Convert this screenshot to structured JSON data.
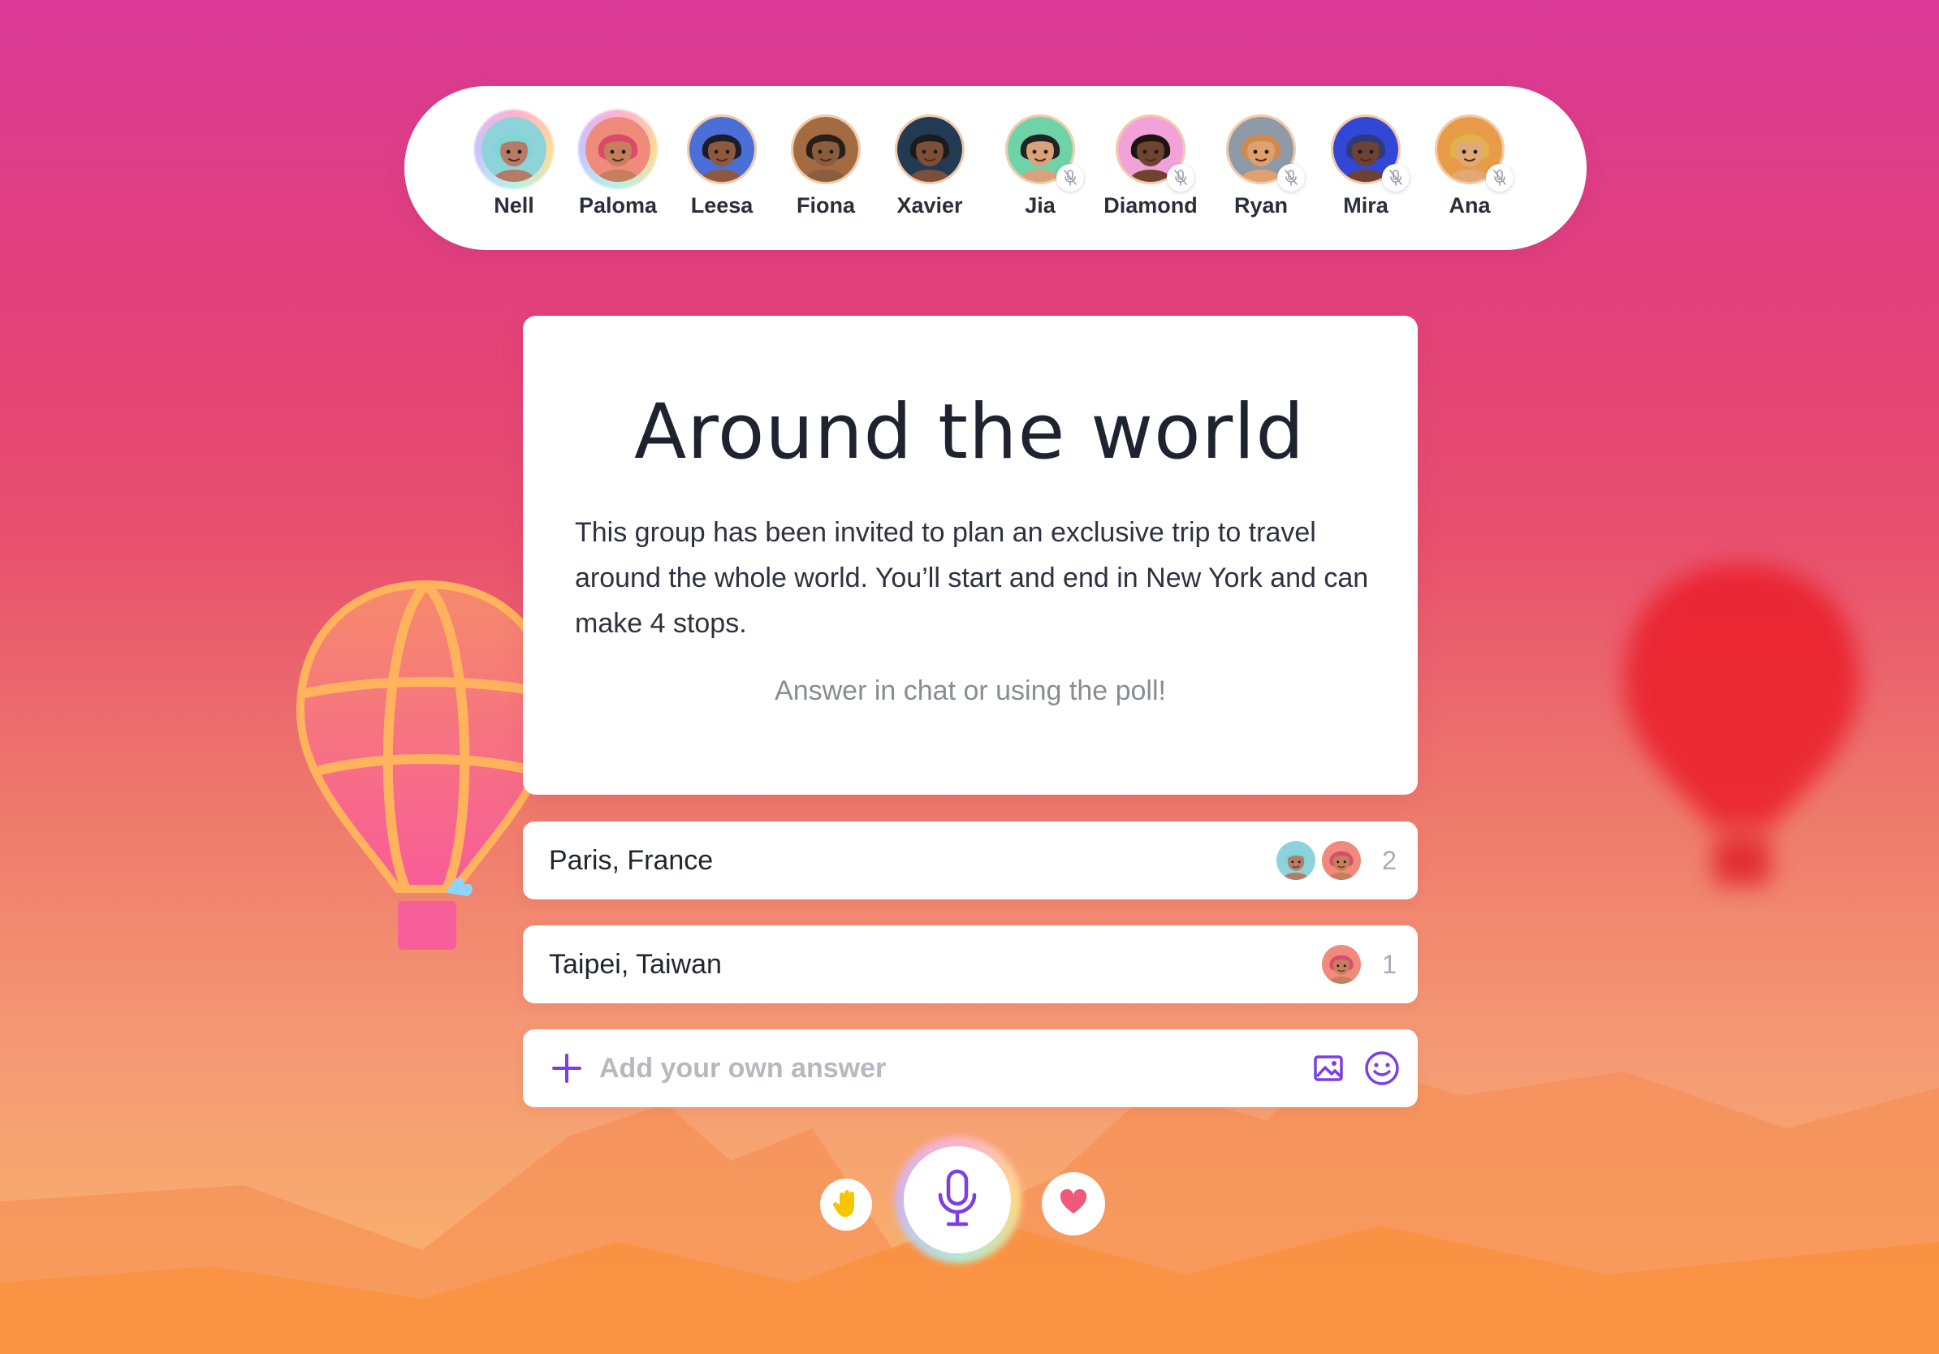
{
  "participants": [
    {
      "name": "Nell",
      "muted": false,
      "skin": "#b57b66",
      "hair": "#7fd6d9",
      "bg": "#8fd3da",
      "speaking": true
    },
    {
      "name": "Paloma",
      "muted": false,
      "skin": "#c57f5c",
      "hair": "#d94b6b",
      "bg": "#f08a7a",
      "speaking": true
    },
    {
      "name": "Leesa",
      "muted": false,
      "skin": "#8d5a3f",
      "hair": "#1d1d2a",
      "bg": "#4b6fd6",
      "speaking": false
    },
    {
      "name": "Fiona",
      "muted": false,
      "skin": "#8a5d3e",
      "hair": "#2a1f18",
      "bg": "#a26b42",
      "speaking": false
    },
    {
      "name": "Xavier",
      "muted": false,
      "skin": "#7c5038",
      "hair": "#1b1b1b",
      "bg": "#233a54",
      "speaking": false
    },
    {
      "name": "Jia",
      "muted": true,
      "skin": "#d9a27d",
      "hair": "#222222",
      "bg": "#6fd3a8",
      "speaking": false
    },
    {
      "name": "Diamond",
      "muted": true,
      "skin": "#6e4430",
      "hair": "#1e1410",
      "bg": "#f3a1d9",
      "speaking": false
    },
    {
      "name": "Ryan",
      "muted": true,
      "skin": "#e0a070",
      "hair": "#cf8a4e",
      "bg": "#8f9aa8",
      "speaking": false
    },
    {
      "name": "Mira",
      "muted": true,
      "skin": "#6b4233",
      "hair": "#2e3a7a",
      "bg": "#3347d6",
      "speaking": false
    },
    {
      "name": "Ana",
      "muted": true,
      "skin": "#e2a978",
      "hair": "#e0b24d",
      "bg": "#e89c47",
      "speaking": false
    }
  ],
  "prompt": {
    "title": "Around the world",
    "body": "This group has been invited to plan an exclusive trip to travel around the whole world. You’ll start and end in New York and can make 4 stops.",
    "hint": "Answer in chat or using the poll!"
  },
  "poll": {
    "options": [
      {
        "label": "Paris, France",
        "count": "2",
        "voters": [
          "Nell",
          "Paloma"
        ]
      },
      {
        "label": "Taipei, Taiwan",
        "count": "1",
        "voters": [
          "Paloma"
        ]
      }
    ],
    "add_placeholder": "Add your own answer"
  },
  "icons": {
    "add": "plus-icon",
    "image": "image-icon",
    "emoji": "smiley-icon",
    "hand": "raised-hand-icon",
    "mic": "microphone-icon",
    "reaction": "heart-icon",
    "muted": "mic-off-icon"
  },
  "colors": {
    "accent": "#7b3fe4",
    "hand": "#f7c600",
    "heart": "#ef5a78",
    "background_top": "#d93a96",
    "background_bottom": "#fab56a"
  }
}
